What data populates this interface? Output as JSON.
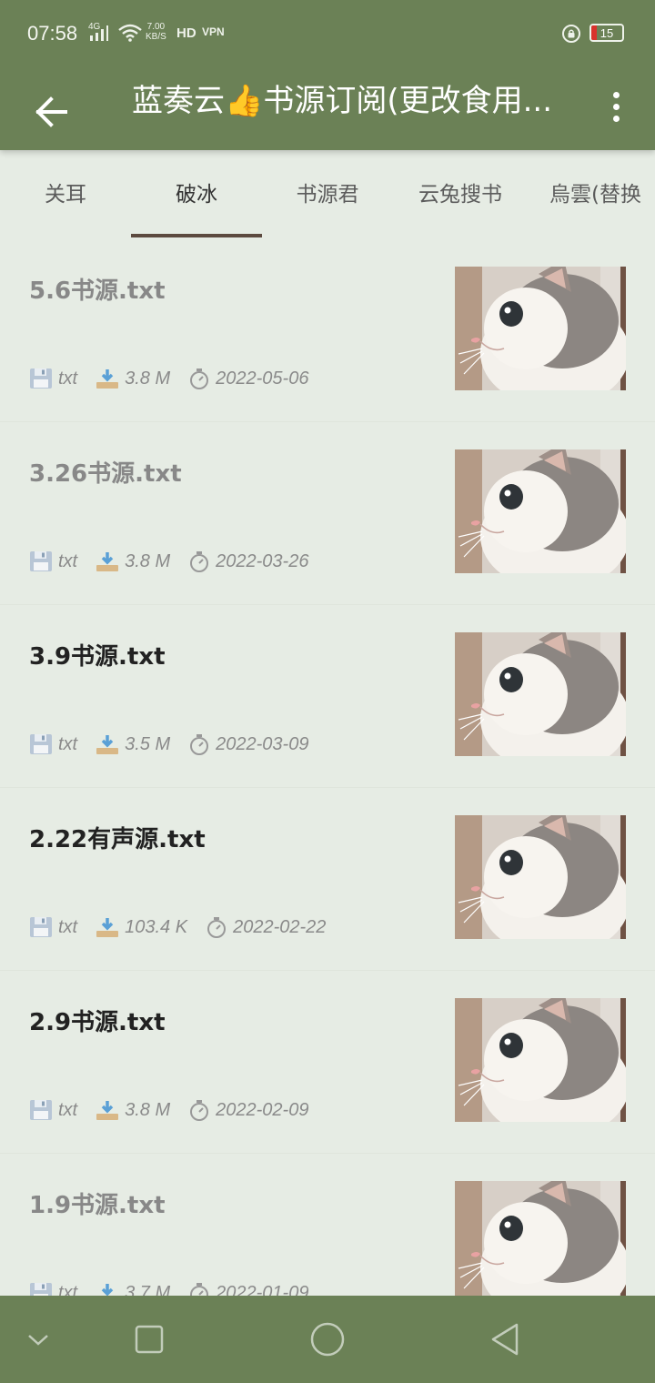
{
  "status_bar": {
    "time": "07:58",
    "signal": "4G",
    "net_speed_value": "7.00",
    "net_speed_unit": "KB/S",
    "hd": "HD",
    "vpn": "VPN",
    "battery": "15",
    "icons": [
      "signal-icon",
      "wifi-icon",
      "lock-rotation-icon",
      "battery-icon"
    ]
  },
  "app_bar": {
    "title": "蓝奏云👍书源订阅(更改食用...",
    "back_icon": "arrow-left-icon",
    "more_icon": "more-vertical-icon"
  },
  "tabs": [
    {
      "label": "关耳"
    },
    {
      "label": "破冰",
      "active": true
    },
    {
      "label": "书源君"
    },
    {
      "label": "云兔搜书"
    },
    {
      "label": "烏雲(替换"
    }
  ],
  "files": [
    {
      "name": "5.6书源.txt",
      "type": "txt",
      "size": "3.8 M",
      "date": "2022-05-06",
      "read": true
    },
    {
      "name": "3.26书源.txt",
      "type": "txt",
      "size": "3.8 M",
      "date": "2022-03-26",
      "read": true
    },
    {
      "name": "3.9书源.txt",
      "type": "txt",
      "size": "3.5 M",
      "date": "2022-03-09",
      "read": false
    },
    {
      "name": "2.22有声源.txt",
      "type": "txt",
      "size": "103.4 K",
      "date": "2022-02-22",
      "read": false
    },
    {
      "name": "2.9书源.txt",
      "type": "txt",
      "size": "3.8 M",
      "date": "2022-02-09",
      "read": false
    },
    {
      "name": "1.9书源.txt",
      "type": "txt",
      "size": "3.7 M",
      "date": "2022-01-09",
      "read": true
    }
  ],
  "nav_bar": {
    "icons": [
      "chevron-down-icon",
      "recents-square-icon",
      "home-circle-icon",
      "back-triangle-icon"
    ]
  },
  "colors": {
    "accent": "#6b8156",
    "background": "#e6ece4",
    "tab_indicator": "#5c4a3f"
  }
}
